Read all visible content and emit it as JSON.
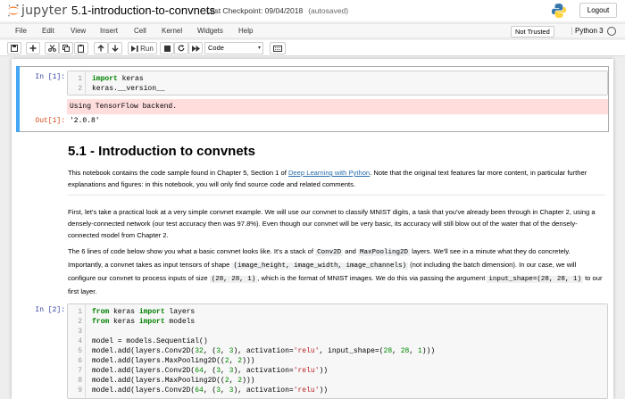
{
  "header": {
    "app_name": "jupyter",
    "notebook_name": "5.1-introduction-to-convnets",
    "checkpoint": "Last Checkpoint: 09/04/2018",
    "save_status": "(autosaved)",
    "logout_label": "Logout"
  },
  "menubar": {
    "items": [
      "File",
      "Edit",
      "View",
      "Insert",
      "Cell",
      "Kernel",
      "Widgets",
      "Help"
    ],
    "trust_label": "Not Trusted",
    "kernel_name": "Python 3"
  },
  "toolbar": {
    "run_label": "Run",
    "cell_type": "Code"
  },
  "cells": {
    "cell1": {
      "prompt": "In [1]:",
      "lines": [
        "1",
        "2"
      ],
      "stderr": "Using TensorFlow backend.",
      "out_prompt": "Out[1]:",
      "output": "'2.0.8'"
    },
    "md1": {
      "title": "5.1 - Introduction to convnets",
      "p1_a": "This notebook contains the code sample found in Chapter 5, Section 1 of ",
      "p1_link": "Deep Learning with Python",
      "p1_b": ". Note that the original text features far more content, in particular further explanations and figures: in this notebook, you will only find source code and related comments."
    },
    "md2": {
      "p2": "First, let's take a practical look at a very simple convnet example. We will use our convnet to classify MNIST digits, a task that you've already been through in Chapter 2, using a densely-connected network (our test accuracy then was 97.8%). Even though our convnet will be very basic, its accuracy will still blow out of the water that of the densely-connected model from Chapter 2.",
      "p3_a": "The 6 lines of code below show you what a basic convnet looks like. It's a stack of ",
      "p3_code1": "Conv2D",
      "p3_b": " and ",
      "p3_code2": "MaxPooling2D",
      "p3_c": " layers. We'll see in a minute what they do concretely. Importantly, a convnet takes as input tensors of shape ",
      "p3_code3": "(image_height, image_width, image_channels)",
      "p3_d": " (not including the batch dimension). In our case, we will configure our convnet to process inputs of size ",
      "p3_code4": "(28, 28, 1)",
      "p3_e": ", which is the format of MNIST images. We do this via passing the argument ",
      "p3_code5": "input_shape=(28, 28, 1)",
      "p3_f": " to our first layer."
    },
    "cell2": {
      "prompt": "In [2]:",
      "lines": [
        "1",
        "2",
        "3",
        "4",
        "5",
        "6",
        "7",
        "8",
        "9"
      ]
    }
  },
  "colors": {
    "selected_bar": "#42a5f5",
    "stderr_bg": "#ffdddd",
    "in_prompt": "#303f9f",
    "out_prompt": "#d84315",
    "keyword": "#008000",
    "string": "#ba2121"
  }
}
